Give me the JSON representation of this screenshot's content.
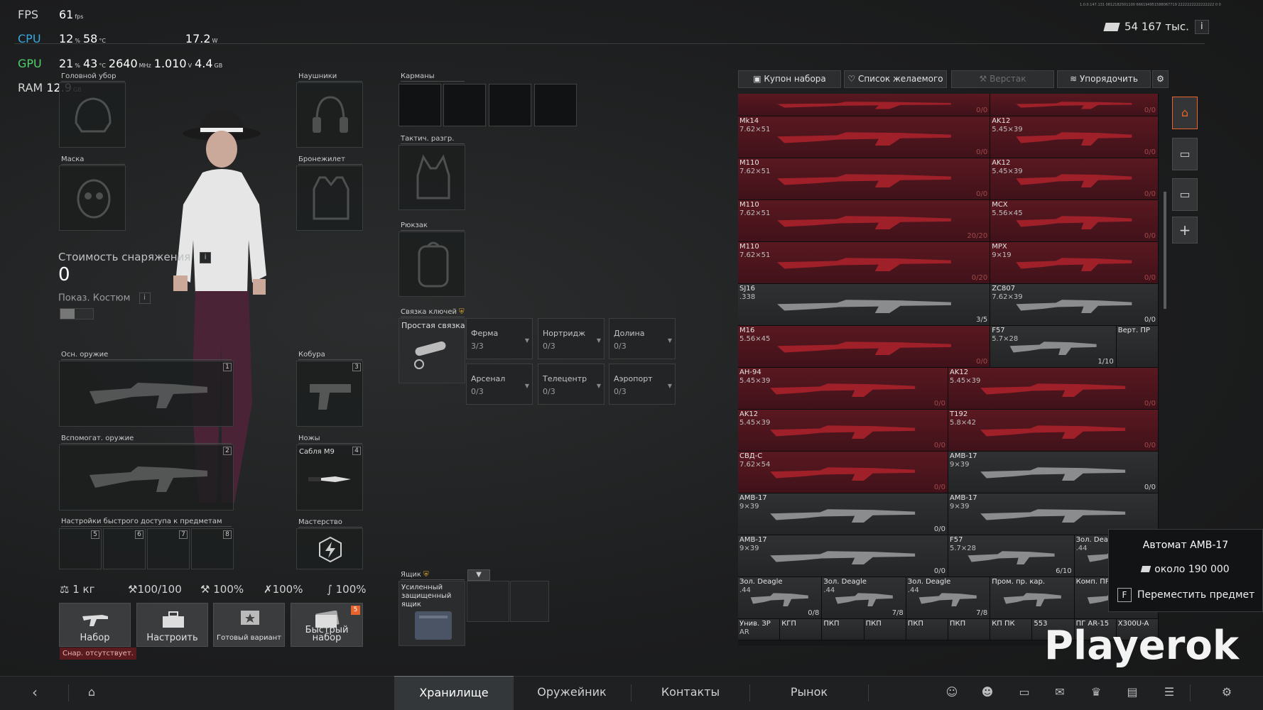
{
  "perf": {
    "fps": {
      "label": "FPS",
      "value": "61",
      "unit": "fps"
    },
    "cpu": {
      "label": "CPU",
      "load": "12",
      "load_unit": "%",
      "temp": "58",
      "temp_unit": "°C",
      "power": "17.2",
      "power_unit": "W"
    },
    "gpu": {
      "label": "GPU",
      "load": "21",
      "load_unit": "%",
      "temp": "43",
      "temp_unit": "°C",
      "clock": "2640",
      "clock_unit": "MHz",
      "volt": "1.010",
      "volt_unit": "V",
      "mem": "4.4",
      "mem_unit": "GB"
    },
    "ram": {
      "label": "RAM",
      "value": "12.9",
      "unit": "GB"
    }
  },
  "version_text": "1.0.0.147.131 0812182501100 666194951588067719 2222222222222222 0 0",
  "currency": {
    "amount": "54 167 тыс.",
    "info": "i",
    "icon": "money-icon"
  },
  "equipment": {
    "headwear": "Головной убор",
    "headphones": "Наушники",
    "mask": "Маска",
    "armor": "Бронежилет",
    "primary": "Осн. оружие",
    "primary_num": "1",
    "holster": "Кобура",
    "holster_num": "3",
    "secondary": "Вспомогат. оружие",
    "secondary_num": "2",
    "knives": "Ножы",
    "knife_num": "4",
    "knife_item": "Сабля М9",
    "quick": "Настройки быстрого доступа к предметам",
    "quick_slots": [
      "5",
      "6",
      "7",
      "8"
    ],
    "mastery": "Мастерство"
  },
  "gear_cost": {
    "label": "Стоимость снаряжения",
    "value": "0",
    "info": "i"
  },
  "costume": {
    "label": "Показ. Костюм",
    "info": "i"
  },
  "stats": {
    "weight": "1 кг",
    "armor": "100/100",
    "s2": "100%",
    "s3": "100%",
    "s4": "100%"
  },
  "actions": [
    {
      "label": "Набор",
      "icon": "rifle-icon"
    },
    {
      "label": "Настроить",
      "icon": "toolbox-icon"
    },
    {
      "label": "Готовый вариант",
      "icon": "preset-icon"
    },
    {
      "label": "Быстрый набор",
      "icon": "cards-icon",
      "badge": "5"
    }
  ],
  "warning": "Снар. отсутствует.",
  "containers": {
    "pockets": "Карманы",
    "rig": "Тактич. разгр.",
    "backpack": "Рюкзак",
    "keyring": "Связка ключей",
    "keyring_item": "Простая связка",
    "keys": [
      {
        "name": "Ферма",
        "count": "3/3"
      },
      {
        "name": "Нортридж",
        "count": "0/3"
      },
      {
        "name": "Долина",
        "count": "0/3"
      },
      {
        "name": "Арсенал",
        "count": "0/3"
      },
      {
        "name": "Телецентр",
        "count": "0/3"
      },
      {
        "name": "Аэропорт",
        "count": "0/3"
      }
    ],
    "box": "Ящик",
    "box_item": "Усиленный защищенный ящик"
  },
  "toolbar": [
    "Купон набора",
    "Список желаемого",
    "Верстак",
    "Упорядочить"
  ],
  "stash": [
    {
      "name": "",
      "cal": "",
      "count": "0/0",
      "color": "red",
      "c": 0,
      "r": 0,
      "w": 6,
      "h": 0.55
    },
    {
      "name": "",
      "cal": "",
      "count": "0/0",
      "color": "red",
      "c": 6,
      "r": 0,
      "w": 4,
      "h": 0.55
    },
    {
      "name": "Mk14",
      "cal": "7.62×51",
      "count": "0/0",
      "color": "red",
      "c": 0,
      "r": 0.55,
      "w": 6,
      "h": 1
    },
    {
      "name": "AK12",
      "cal": "5.45×39",
      "count": "0/0",
      "color": "red",
      "c": 6,
      "r": 0.55,
      "w": 4,
      "h": 1
    },
    {
      "name": "M110",
      "cal": "7.62×51",
      "count": "0/0",
      "color": "red",
      "c": 0,
      "r": 1.55,
      "w": 6,
      "h": 1
    },
    {
      "name": "AK12",
      "cal": "5.45×39",
      "count": "0/0",
      "color": "red",
      "c": 6,
      "r": 1.55,
      "w": 4,
      "h": 1
    },
    {
      "name": "M110",
      "cal": "7.62×51",
      "count": "20/20",
      "color": "red",
      "c": 0,
      "r": 2.55,
      "w": 6,
      "h": 1
    },
    {
      "name": "MCX",
      "cal": "5.56×45",
      "count": "0/0",
      "color": "red",
      "c": 6,
      "r": 2.55,
      "w": 4,
      "h": 1
    },
    {
      "name": "M110",
      "cal": "7.62×51",
      "count": "0/20",
      "color": "red",
      "c": 0,
      "r": 3.55,
      "w": 6,
      "h": 1
    },
    {
      "name": "MPX",
      "cal": "9×19",
      "count": "0/0",
      "color": "red",
      "c": 6,
      "r": 3.55,
      "w": 4,
      "h": 1
    },
    {
      "name": "SJ16",
      "cal": ".338",
      "count": "3/5",
      "color": "gray",
      "c": 0,
      "r": 4.55,
      "w": 6,
      "h": 1
    },
    {
      "name": "ZC807",
      "cal": "7.62×39",
      "count": "0/0",
      "color": "gray",
      "c": 6,
      "r": 4.55,
      "w": 4,
      "h": 1
    },
    {
      "name": "M16",
      "cal": "5.56×45",
      "count": "0/0",
      "color": "red",
      "c": 0,
      "r": 5.55,
      "w": 6,
      "h": 1
    },
    {
      "name": "F57",
      "cal": "5.7×28",
      "count": "1/10",
      "color": "gray",
      "c": 6,
      "r": 5.55,
      "w": 3,
      "h": 1
    },
    {
      "name": "Верт. ПР",
      "cal": "",
      "count": "",
      "color": "gray",
      "c": 9,
      "r": 5.55,
      "w": 1,
      "h": 1
    },
    {
      "name": "AH-94",
      "cal": "5.45×39",
      "count": "0/0",
      "color": "red",
      "c": 0,
      "r": 6.55,
      "w": 5,
      "h": 1
    },
    {
      "name": "AK12",
      "cal": "5.45×39",
      "count": "0/0",
      "color": "red",
      "c": 5,
      "r": 6.55,
      "w": 5,
      "h": 1
    },
    {
      "name": "AK12",
      "cal": "5.45×39",
      "count": "0/0",
      "color": "red",
      "c": 0,
      "r": 7.55,
      "w": 5,
      "h": 1
    },
    {
      "name": "T192",
      "cal": "5.8×42",
      "count": "0/0",
      "color": "red",
      "c": 5,
      "r": 7.55,
      "w": 5,
      "h": 1
    },
    {
      "name": "СВД-С",
      "cal": "7.62×54",
      "count": "0/0",
      "color": "red",
      "c": 0,
      "r": 8.55,
      "w": 5,
      "h": 1
    },
    {
      "name": "AMB-17",
      "cal": "9×39",
      "count": "0/0",
      "color": "gray",
      "c": 5,
      "r": 8.55,
      "w": 5,
      "h": 1
    },
    {
      "name": "AMB-17",
      "cal": "9×39",
      "count": "0/0",
      "color": "gray",
      "c": 0,
      "r": 9.55,
      "w": 5,
      "h": 1
    },
    {
      "name": "AMB-17",
      "cal": "9×39",
      "count": "",
      "color": "gray",
      "c": 5,
      "r": 9.55,
      "w": 5,
      "h": 1
    },
    {
      "name": "AMB-17",
      "cal": "9×39",
      "count": "0/0",
      "color": "gray",
      "c": 0,
      "r": 10.55,
      "w": 5,
      "h": 1
    },
    {
      "name": "F57",
      "cal": "5.7×28",
      "count": "6/10",
      "color": "gray",
      "c": 5,
      "r": 10.55,
      "w": 3,
      "h": 1
    },
    {
      "name": "Зол. Deagle",
      "cal": ".44",
      "count": "",
      "color": "gray",
      "c": 8,
      "r": 10.55,
      "w": 2,
      "h": 1
    },
    {
      "name": "Зол. Deagle",
      "cal": ".44",
      "count": "0/8",
      "color": "gray",
      "c": 0,
      "r": 11.55,
      "w": 2,
      "h": 1
    },
    {
      "name": "Зол. Deagle",
      "cal": ".44",
      "count": "7/8",
      "color": "gray",
      "c": 2,
      "r": 11.55,
      "w": 2,
      "h": 1
    },
    {
      "name": "Зол. Deagle",
      "cal": ".44",
      "count": "7/8",
      "color": "gray",
      "c": 4,
      "r": 11.55,
      "w": 2,
      "h": 1
    },
    {
      "name": "Пром. пр. кар.",
      "cal": "",
      "count": "",
      "color": "gray",
      "c": 6,
      "r": 11.55,
      "w": 2,
      "h": 1
    },
    {
      "name": "Комп. ПР",
      "cal": "",
      "count": "",
      "color": "gray",
      "c": 8,
      "r": 11.55,
      "w": 2,
      "h": 1
    },
    {
      "name": "Унив. ЗР",
      "cal": "AR",
      "count": "",
      "color": "gray",
      "c": 0,
      "r": 12.55,
      "w": 1,
      "h": 0.5
    },
    {
      "name": "КГП",
      "cal": "",
      "count": "",
      "color": "gray",
      "c": 1,
      "r": 12.55,
      "w": 1,
      "h": 0.5
    },
    {
      "name": "ПКП",
      "cal": "",
      "count": "",
      "color": "gray",
      "c": 2,
      "r": 12.55,
      "w": 1,
      "h": 0.5
    },
    {
      "name": "ПКП",
      "cal": "",
      "count": "",
      "color": "gray",
      "c": 3,
      "r": 12.55,
      "w": 1,
      "h": 0.5
    },
    {
      "name": "ПКП",
      "cal": "",
      "count": "",
      "color": "gray",
      "c": 4,
      "r": 12.55,
      "w": 1,
      "h": 0.5
    },
    {
      "name": "ПКП",
      "cal": "",
      "count": "",
      "color": "gray",
      "c": 5,
      "r": 12.55,
      "w": 1,
      "h": 0.5
    },
    {
      "name": "КП ПК",
      "cal": "",
      "count": "",
      "color": "gray",
      "c": 6,
      "r": 12.55,
      "w": 1,
      "h": 0.5
    },
    {
      "name": "553",
      "cal": "",
      "count": "",
      "color": "gray",
      "c": 7,
      "r": 12.55,
      "w": 1,
      "h": 0.5
    },
    {
      "name": "ПГ AR-15",
      "cal": "",
      "count": "",
      "color": "gray",
      "c": 8,
      "r": 12.55,
      "w": 1,
      "h": 0.5
    },
    {
      "name": "X300U-A",
      "cal": "",
      "count": "",
      "color": "gray",
      "c": 9,
      "r": 12.55,
      "w": 1,
      "h": 0.5
    }
  ],
  "tooltip": {
    "title": "Автомат AMB-17",
    "price": "около 190 000",
    "key": "F",
    "action": "Переместить предмет"
  },
  "watermark": "Playerok",
  "nav": {
    "tabs": [
      "Хранилище",
      "Оружейник",
      "Контакты",
      "Рынок"
    ],
    "active": 0
  },
  "colors": {
    "accent": "#e8642c",
    "red_cell": "#5a1820",
    "cpu": "#38a8e0",
    "gpu": "#4fd16a"
  }
}
